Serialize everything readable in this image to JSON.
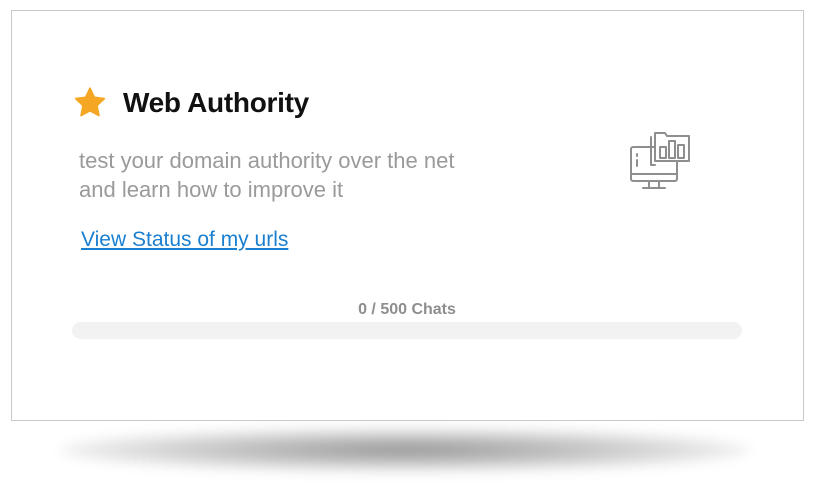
{
  "card": {
    "title": "Web Authority",
    "title_icon": "star-icon",
    "description": "test your domain authority over the net and learn how to improve it",
    "link_label": "View Status of my urls",
    "illustration_icon": "monitor-chart-icon",
    "usage": {
      "label": "0 / 500 Chats",
      "used": 0,
      "limit": 500,
      "fraction": 0
    }
  },
  "colors": {
    "star": "#F5A623",
    "title": "#111111",
    "description": "#9A9A9A",
    "link": "#1A7FD0",
    "icon_stroke": "#8E8E8E",
    "progress_track": "#F2F2F2"
  }
}
